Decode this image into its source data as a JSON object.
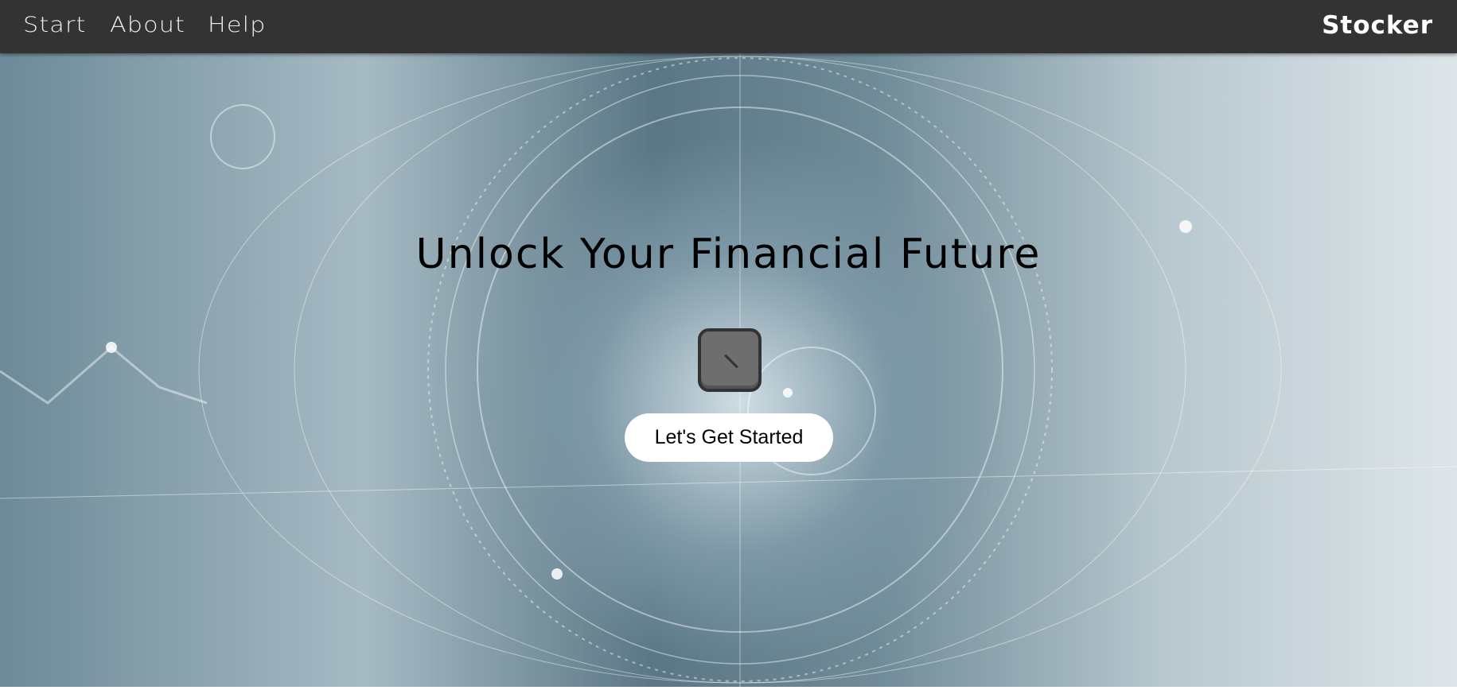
{
  "nav": {
    "links": [
      "Start",
      "About",
      "Help"
    ],
    "brand": "Stocker"
  },
  "hero": {
    "title": "Unlock Your Financial Future",
    "cta": "Let's Get Started",
    "loader_icon": "spinner-icon"
  }
}
